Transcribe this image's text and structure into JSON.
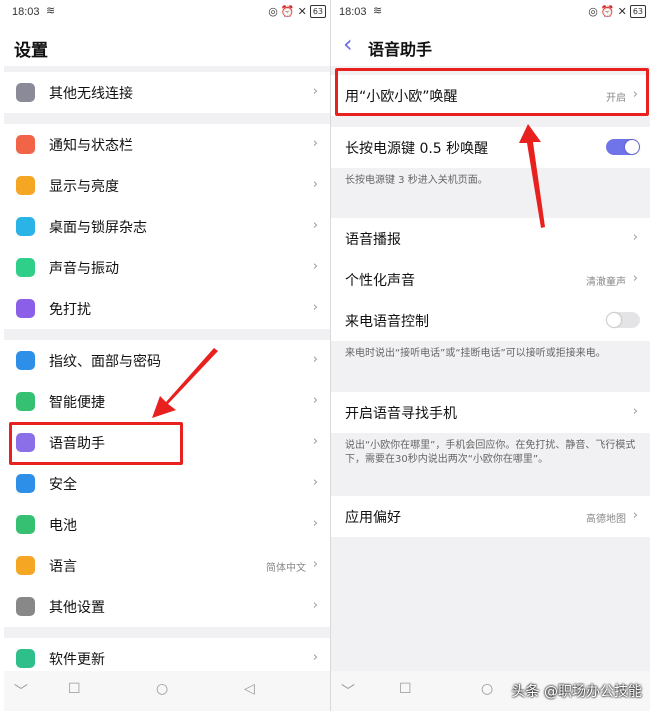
{
  "status": {
    "time": "18:03",
    "battery": "63"
  },
  "left": {
    "title": "设置",
    "items": [
      {
        "label": "其他无线连接",
        "icon": "more-dots-icon",
        "color": "#8a8a98"
      },
      {
        "label": "通知与状态栏",
        "icon": "notification-icon",
        "color": "#f26447"
      },
      {
        "label": "显示与亮度",
        "icon": "brightness-icon",
        "color": "#f5a623"
      },
      {
        "label": "桌面与锁屏杂志",
        "icon": "wallpaper-icon",
        "color": "#2ab3e6"
      },
      {
        "label": "声音与振动",
        "icon": "sound-icon",
        "color": "#2fcf8a"
      },
      {
        "label": "免打扰",
        "icon": "moon-icon",
        "color": "#8b5fe8"
      },
      {
        "label": "指纹、面部与密码",
        "icon": "fingerprint-icon",
        "color": "#2e8fe8"
      },
      {
        "label": "智能便捷",
        "icon": "smart-icon",
        "color": "#36c172"
      },
      {
        "label": "语音助手",
        "icon": "microphone-icon",
        "color": "#8b6fe8"
      },
      {
        "label": "安全",
        "icon": "shield-icon",
        "color": "#2e8fe8"
      },
      {
        "label": "电池",
        "icon": "battery-icon",
        "color": "#36c172"
      },
      {
        "label": "语言",
        "icon": "language-icon",
        "color": "#f5a623",
        "value": "简体中文"
      },
      {
        "label": "其他设置",
        "icon": "gear-icon",
        "color": "#888888"
      },
      {
        "label": "软件更新",
        "icon": "update-icon",
        "color": "#2fbf8a"
      }
    ]
  },
  "right": {
    "title": "语音助手",
    "wake": {
      "label": "用“小欧小欧”唤醒",
      "value": "开启"
    },
    "power": {
      "label": "长按电源键 0.5 秒唤醒",
      "on": true,
      "note": "长按电源键 3 秒进入关机页面。"
    },
    "broadcast": {
      "label": "语音播报"
    },
    "voice": {
      "label": "个性化声音",
      "value": "清澈童声"
    },
    "call": {
      "label": "来电语音控制",
      "on": false,
      "note": "来电时说出“接听电话”或“挂断电话”可以接听或拒接来电。"
    },
    "find": {
      "label": "开启语音寻找手机",
      "note": "说出“小欧你在哪里”，手机会回应你。在免打扰、静音、飞行模式下，需要在30秒内说出两次“小欧你在哪里”。"
    },
    "app": {
      "label": "应用偏好",
      "value": "高德地图"
    }
  },
  "watermark": "头条 @职场办公技能"
}
